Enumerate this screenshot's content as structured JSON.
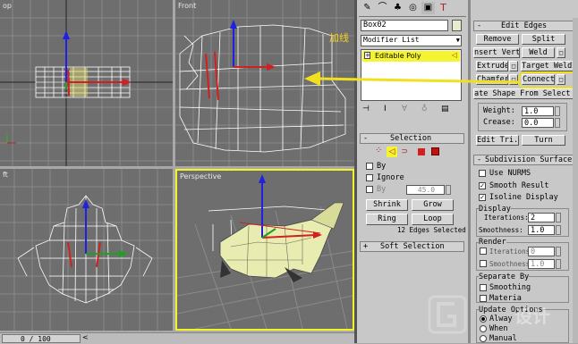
{
  "viewports": {
    "top": {
      "label": "op"
    },
    "front": {
      "label": "Front",
      "annotation": "加线"
    },
    "left": {
      "label": "ft"
    },
    "perspective": {
      "label": "Perspective"
    }
  },
  "timeline": {
    "frame": "0 / 100"
  },
  "modify": {
    "object_name": "Box02",
    "modifier_list": "Modifier List",
    "stack_item": "Editable Poly",
    "tool_icons": [
      "pin-stack-icon",
      "show-end-result-icon",
      "make-unique-icon",
      "remove-modifier-icon",
      "configure-modifier-sets-icon"
    ]
  },
  "tabs": [
    "create-tab-icon",
    "modify-tab-icon",
    "hierarchy-tab-icon",
    "motion-tab-icon",
    "display-tab-icon",
    "utilities-tab-icon"
  ],
  "selection": {
    "title": "Selection",
    "by_vertex": "By",
    "ignore_backfacing": "Ignore",
    "by_angle": "By",
    "angle_value": "45.0",
    "shrink": "Shrink",
    "grow": "Grow",
    "ring": "Ring",
    "loop": "Loop",
    "status": "12 Edges Selected"
  },
  "soft_selection": {
    "title": "Soft Selection"
  },
  "edit_edges": {
    "title": "Edit Edges",
    "remove": "Remove",
    "split": "Split",
    "insert_vertex": "nsert Verte",
    "weld": "Weld",
    "extrude": "Extrude",
    "target_weld": "Target Weld",
    "chamfer": "Chamfer",
    "connect": "Connect",
    "create_shape": "ate Shape From Select",
    "weight_label": "Weight:",
    "weight_value": "1.0",
    "crease_label": "Crease:",
    "crease_value": "0.0",
    "edit_tri": "Edit Tri.",
    "turn": "Turn"
  },
  "subdivision": {
    "title": "Subdivision Surface",
    "use_nurms": "Use NURMS",
    "smooth_result": "Smooth Result",
    "isoline_display": "Isoline Display",
    "display_group": "Display",
    "iterations_label": "Iterations:",
    "display_iterations": "2",
    "smoothness_label": "Smoothness:",
    "display_smoothness": "1.0",
    "render_group": "Render",
    "render_iterations": "0",
    "render_smoothness": "1.0",
    "separate_by": "Separate By",
    "smoothing": "Smoothing",
    "materials": "Materia",
    "update_options": "Update Options",
    "always": "Alway",
    "when": "When",
    "manual": "Manual"
  },
  "watermark": "设计"
}
